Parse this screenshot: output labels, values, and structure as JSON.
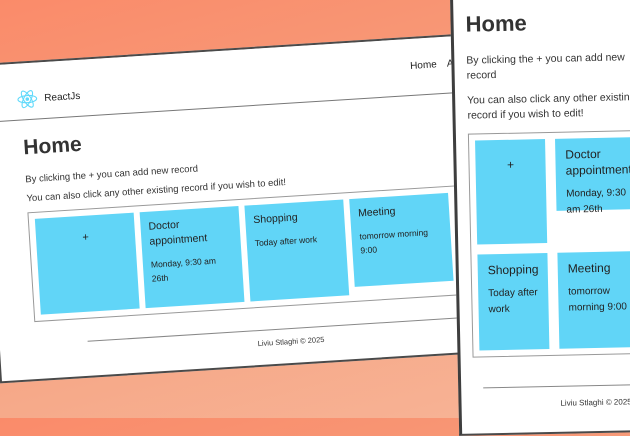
{
  "brand": {
    "name": "ReactJs",
    "logo_icon": "react-logo-icon",
    "logo_color": "#61dafb"
  },
  "nav": {
    "links": [
      "Home",
      "About"
    ]
  },
  "page": {
    "title": "Home",
    "intro_add": "By clicking the + you can add new record",
    "intro_edit": "You can also click any other existing record if you wish to edit!"
  },
  "records": {
    "add_label": "+",
    "items": [
      {
        "title": "Doctor appointment",
        "desc": "Monday, 9:30 am 26th"
      },
      {
        "title": "Shopping",
        "desc": "Today after work"
      },
      {
        "title": "Meeting",
        "desc": "tomorrow morning 9:00"
      }
    ]
  },
  "footer": {
    "text": "Liviu Stlaghi © 2025"
  },
  "colors": {
    "card": "#61d5f7",
    "background": "#fa8b6a"
  }
}
